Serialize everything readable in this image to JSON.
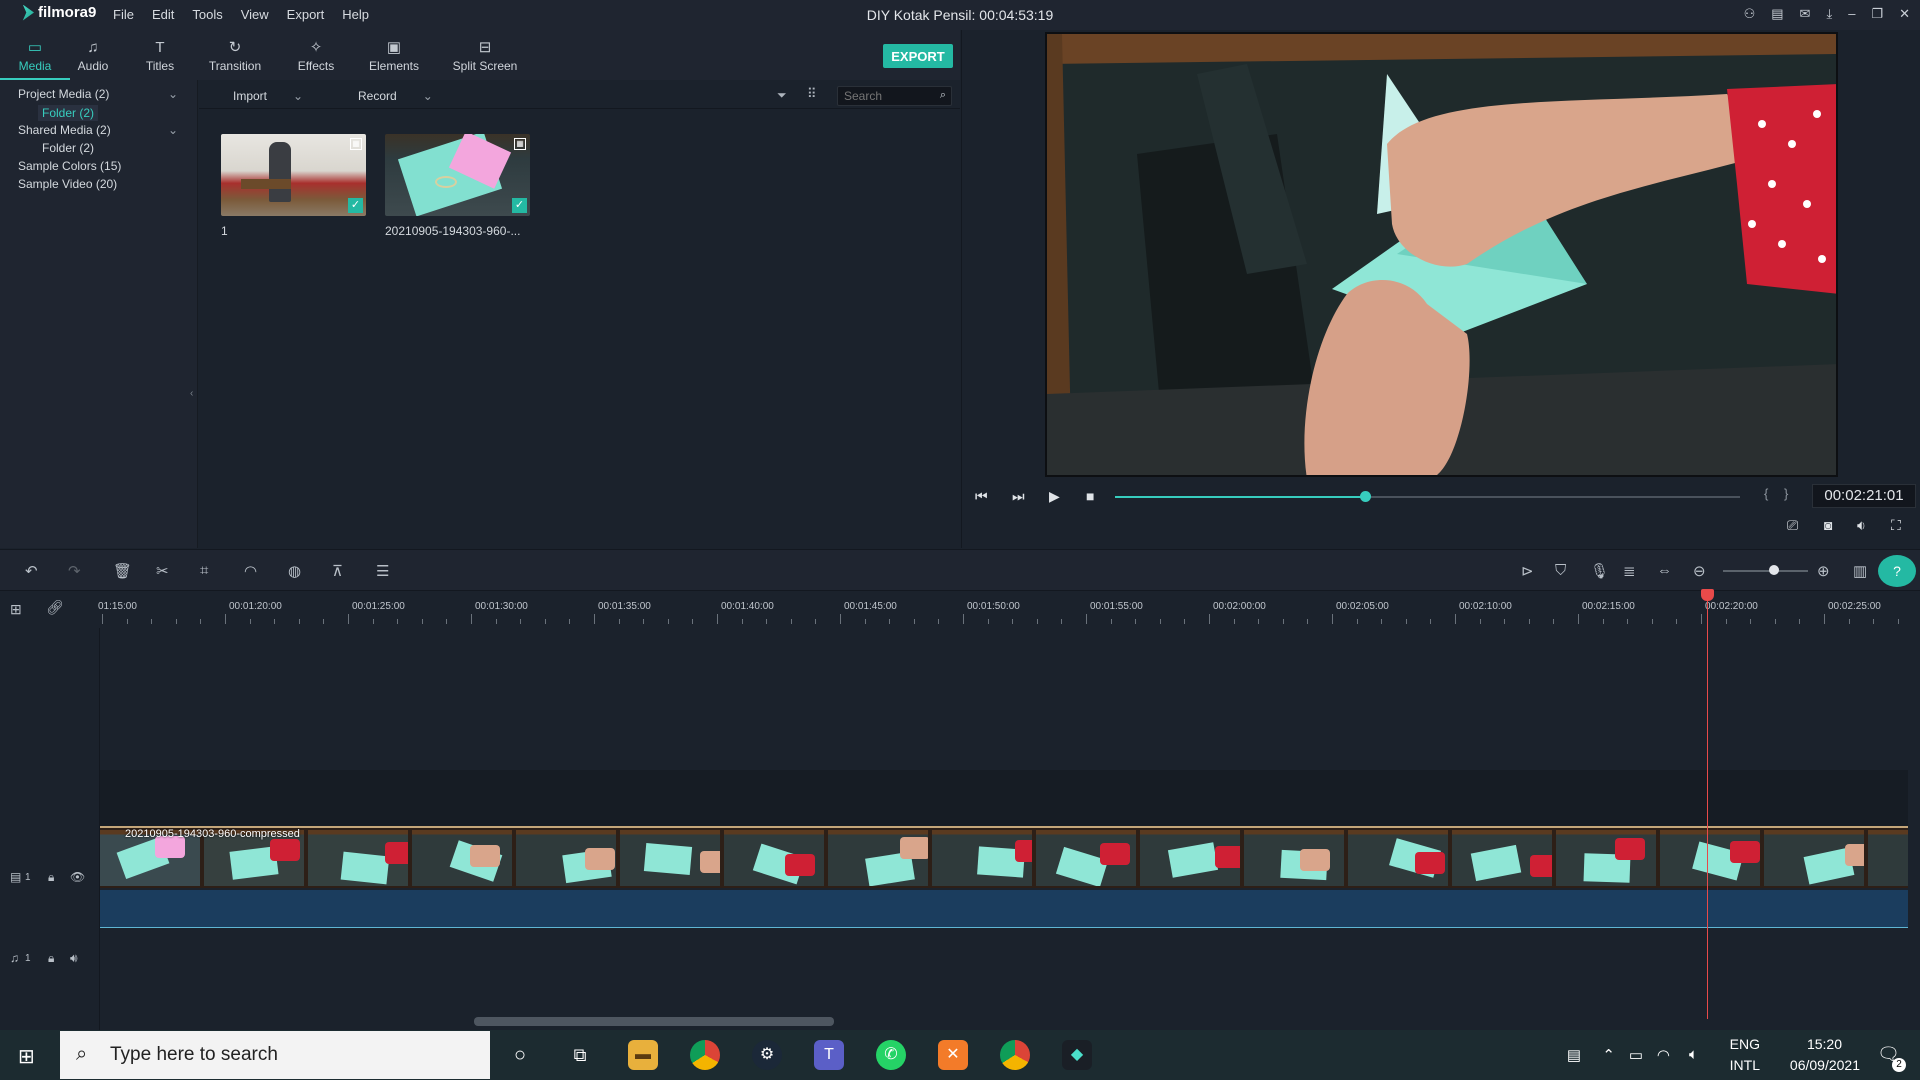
{
  "app": {
    "logo_text": "filmora9",
    "menu": [
      "File",
      "Edit",
      "Tools",
      "View",
      "Export",
      "Help"
    ],
    "document_title": "DIY Kotak Pensil: 00:04:53:19"
  },
  "tabs": [
    {
      "label": "Media",
      "icon": "folder-icon",
      "glyph": "▭"
    },
    {
      "label": "Audio",
      "icon": "music-note-icon",
      "glyph": "♫"
    },
    {
      "label": "Titles",
      "icon": "text-icon",
      "glyph": "T"
    },
    {
      "label": "Transition",
      "icon": "transition-icon",
      "glyph": "↻"
    },
    {
      "label": "Effects",
      "icon": "effects-icon",
      "glyph": "✧"
    },
    {
      "label": "Elements",
      "icon": "image-icon",
      "glyph": "▣"
    },
    {
      "label": "Split Screen",
      "icon": "split-screen-icon",
      "glyph": "⊟"
    }
  ],
  "export_label": "EXPORT",
  "media_tree": [
    {
      "label": "Project Media (2)",
      "expandable": true
    },
    {
      "label": "Folder (2)",
      "selected": true
    },
    {
      "label": "Shared Media (2)",
      "expandable": true
    },
    {
      "label": "Folder (2)"
    },
    {
      "label": "Sample Colors (15)"
    },
    {
      "label": "Sample Video (20)"
    }
  ],
  "media_toolbar": {
    "import_label": "Import",
    "record_label": "Record",
    "search_placeholder": "Search"
  },
  "media_items": [
    {
      "label": "1",
      "checked": true
    },
    {
      "label": "20210905-194303-960-...",
      "checked": true
    }
  ],
  "player": {
    "timecode": "00:02:21:01",
    "progress": 0.4,
    "bracket_left": "{",
    "bracket_right": "}"
  },
  "ruler_labels": [
    "01:15:00",
    "00:01:20:00",
    "00:01:25:00",
    "00:01:30:00",
    "00:01:35:00",
    "00:01:40:00",
    "00:01:45:00",
    "00:01:50:00",
    "00:01:55:00",
    "00:02:00:00",
    "00:02:05:00",
    "00:02:10:00",
    "00:02:15:00",
    "00:02:20:00",
    "00:02:25:00"
  ],
  "timeline": {
    "clip_label": "20210905-194303-960-compressed",
    "video_track_number": "1",
    "audio_track_number": "1",
    "zoom_level": 0.6
  },
  "taskbar": {
    "search_placeholder": "Type here to search",
    "lang_top": "ENG",
    "lang_bottom": "INTL",
    "time": "15:20",
    "date": "06/09/2021",
    "notification_count": "2"
  },
  "colors": {
    "accent": "#24b9a3",
    "playhead": "#e84a4a",
    "audio_band": "#1b3d5e"
  }
}
